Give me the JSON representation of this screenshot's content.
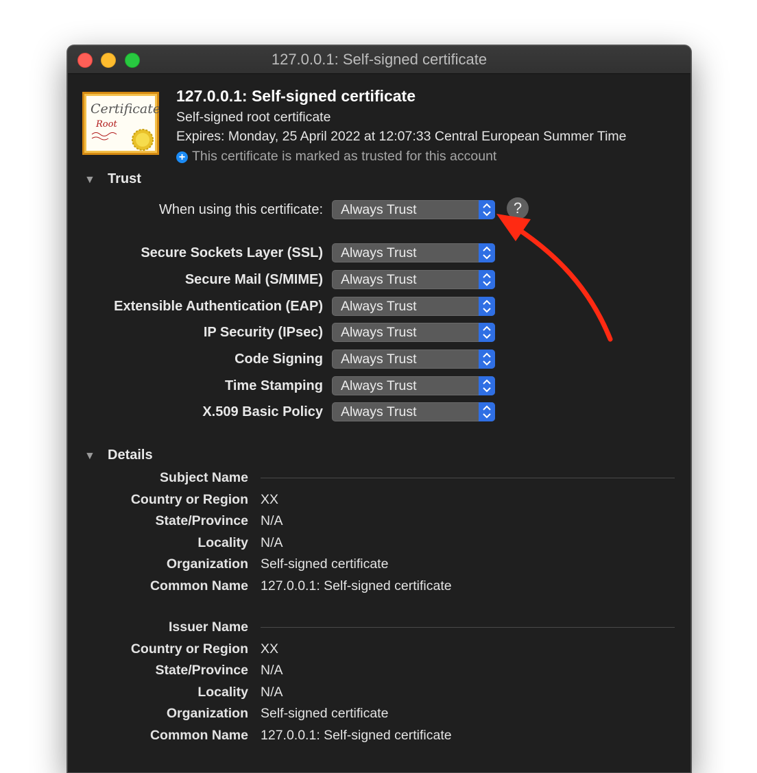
{
  "window": {
    "title": "127.0.0.1: Self-signed certificate"
  },
  "header": {
    "title": "127.0.0.1: Self-signed certificate",
    "subtitle": "Self-signed root certificate",
    "expires": "Expires: Monday, 25 April 2022 at 12:07:33 Central European Summer Time",
    "trusted_note": "This certificate is marked as trusted for this account",
    "certificate_image_text": "Certificate",
    "certificate_image_subtext": "Root"
  },
  "trust": {
    "heading": "Trust",
    "when_using_label": "When using this certificate:",
    "when_using_value": "Always Trust",
    "help_label": "?",
    "policies": [
      {
        "label": "Secure Sockets Layer (SSL)",
        "value": "Always Trust"
      },
      {
        "label": "Secure Mail (S/MIME)",
        "value": "Always Trust"
      },
      {
        "label": "Extensible Authentication (EAP)",
        "value": "Always Trust"
      },
      {
        "label": "IP Security (IPsec)",
        "value": "Always Trust"
      },
      {
        "label": "Code Signing",
        "value": "Always Trust"
      },
      {
        "label": "Time Stamping",
        "value": "Always Trust"
      },
      {
        "label": "X.509 Basic Policy",
        "value": "Always Trust"
      }
    ]
  },
  "details": {
    "heading": "Details",
    "subject": {
      "heading": "Subject Name",
      "rows": [
        {
          "label": "Country or Region",
          "value": "XX"
        },
        {
          "label": "State/Province",
          "value": "N/A"
        },
        {
          "label": "Locality",
          "value": "N/A"
        },
        {
          "label": "Organization",
          "value": "Self-signed certificate"
        },
        {
          "label": "Common Name",
          "value": "127.0.0.1: Self-signed certificate"
        }
      ]
    },
    "issuer": {
      "heading": "Issuer Name",
      "rows": [
        {
          "label": "Country or Region",
          "value": "XX"
        },
        {
          "label": "State/Province",
          "value": "N/A"
        },
        {
          "label": "Locality",
          "value": "N/A"
        },
        {
          "label": "Organization",
          "value": "Self-signed certificate"
        },
        {
          "label": "Common Name",
          "value": "127.0.0.1: Self-signed certificate"
        }
      ]
    }
  },
  "colors": {
    "window_bg": "#1f1f1f",
    "popup_bg": "#5a5a5a",
    "popup_arrows": "#2f6fe4",
    "annotation_arrow": "#ff2a12"
  }
}
